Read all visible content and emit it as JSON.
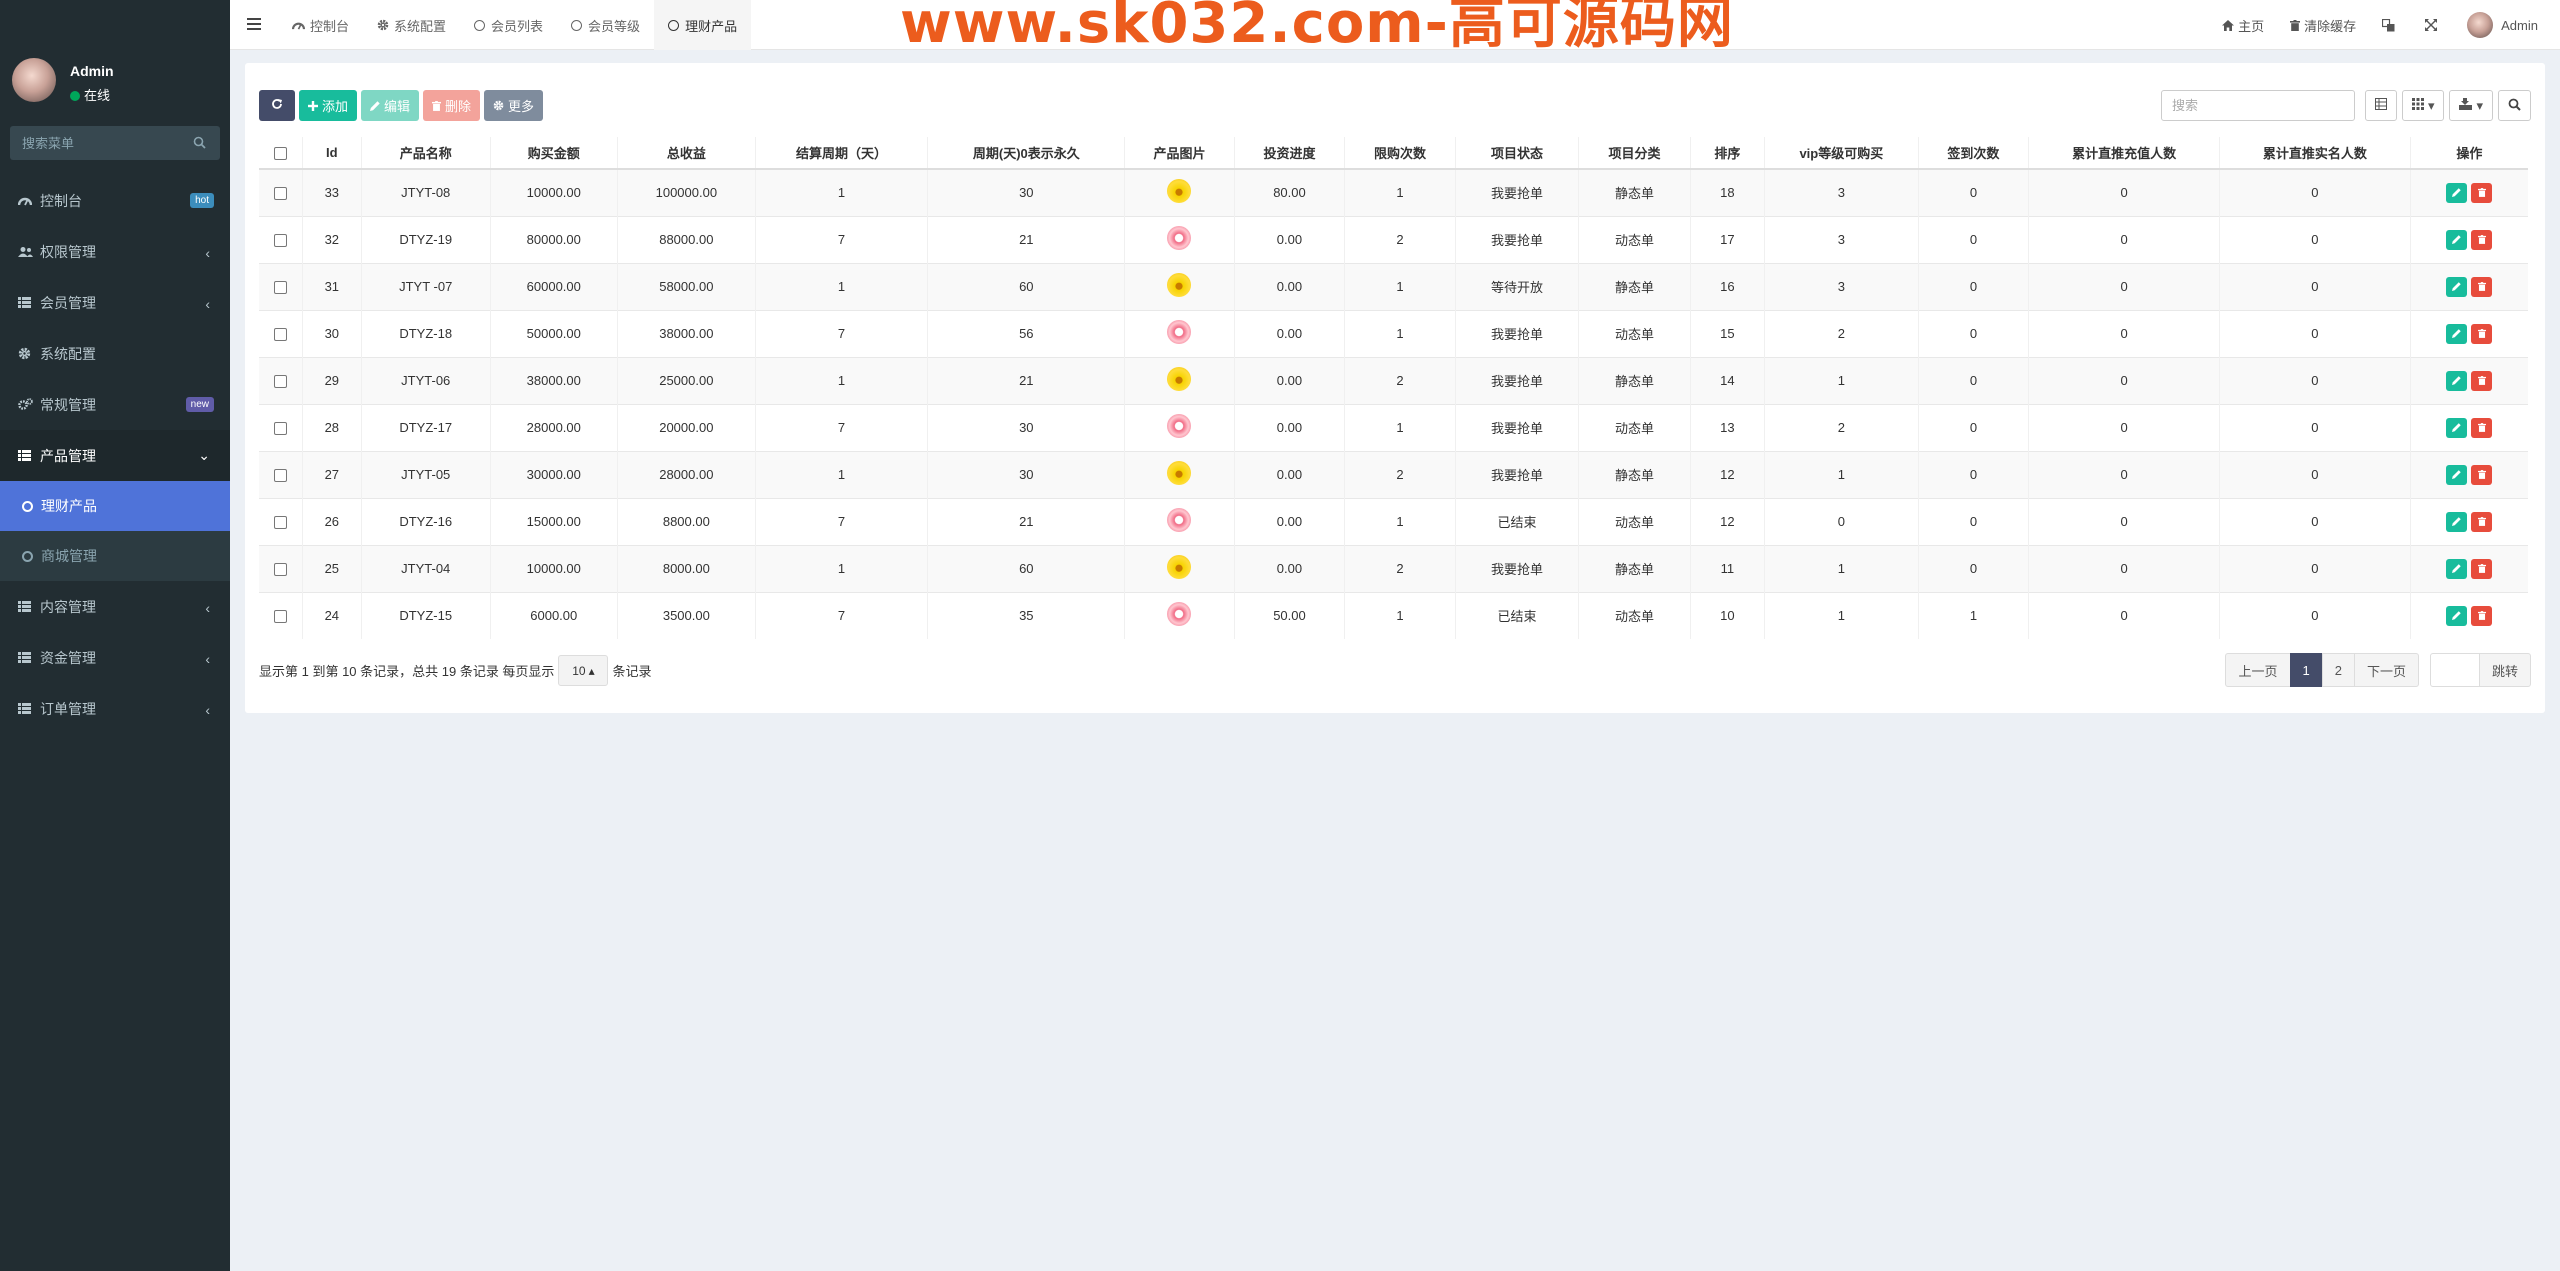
{
  "user": {
    "name": "Admin",
    "status": "在线"
  },
  "menu_search": {
    "placeholder": "搜索菜单"
  },
  "menu": {
    "items": [
      {
        "label": "控制台",
        "badge": "hot"
      },
      {
        "label": "权限管理"
      },
      {
        "label": "会员管理"
      },
      {
        "label": "系统配置"
      },
      {
        "label": "常规管理",
        "badge": "new"
      },
      {
        "label": "产品管理"
      }
    ],
    "product_sub": [
      {
        "label": "理财产品"
      },
      {
        "label": "商城管理"
      }
    ],
    "after": [
      {
        "label": "内容管理"
      },
      {
        "label": "资金管理"
      },
      {
        "label": "订单管理"
      }
    ]
  },
  "tabs": [
    {
      "label": "控制台"
    },
    {
      "label": "系统配置"
    },
    {
      "label": "会员列表"
    },
    {
      "label": "会员等级"
    },
    {
      "label": "理财产品"
    }
  ],
  "watermark": "www.sk032.com-高可源码网",
  "header_right": {
    "home": "主页",
    "clear_cache": "清除缓存",
    "user": "Admin"
  },
  "toolbar": {
    "add": "添加",
    "edit": "编辑",
    "delete": "删除",
    "more": "更多"
  },
  "search": {
    "placeholder": "搜索"
  },
  "table": {
    "columns": [
      "Id",
      "产品名称",
      "购买金额",
      "总收益",
      "结算周期（天）",
      "周期(天)0表示永久",
      "产品图片",
      "投资进度",
      "限购次数",
      "项目状态",
      "项目分类",
      "排序",
      "vip等级可购买",
      "签到次数",
      "累计直推充值人数",
      "累计直推实名人数",
      "操作"
    ],
    "rows": [
      {
        "id": "33",
        "name": "JTYT-08",
        "amount": "10000.00",
        "income": "100000.00",
        "settle": "1",
        "period": "30",
        "img": "yellow",
        "progress": "80.00",
        "limit": "1",
        "status": "我要抢单",
        "status_type": "green",
        "category": "静态单",
        "cat_type": "static",
        "sort": "18",
        "vip": "3",
        "sign": "0",
        "recharge": "0",
        "realname": "0"
      },
      {
        "id": "32",
        "name": "DTYZ-19",
        "amount": "80000.00",
        "income": "88000.00",
        "settle": "7",
        "period": "21",
        "img": "red",
        "progress": "0.00",
        "limit": "2",
        "status": "我要抢单",
        "status_type": "green",
        "category": "动态单",
        "cat_type": "dyn",
        "sort": "17",
        "vip": "3",
        "sign": "0",
        "recharge": "0",
        "realname": "0"
      },
      {
        "id": "31",
        "name": "JTYT -07",
        "amount": "60000.00",
        "income": "58000.00",
        "settle": "1",
        "period": "60",
        "img": "yellow",
        "progress": "0.00",
        "limit": "1",
        "status": "等待开放",
        "status_type": "red",
        "category": "静态单",
        "cat_type": "static",
        "sort": "16",
        "vip": "3",
        "sign": "0",
        "recharge": "0",
        "realname": "0"
      },
      {
        "id": "30",
        "name": "DTYZ-18",
        "amount": "50000.00",
        "income": "38000.00",
        "settle": "7",
        "period": "56",
        "img": "red",
        "progress": "0.00",
        "limit": "1",
        "status": "我要抢单",
        "status_type": "green",
        "category": "动态单",
        "cat_type": "dyn",
        "sort": "15",
        "vip": "2",
        "sign": "0",
        "recharge": "0",
        "realname": "0"
      },
      {
        "id": "29",
        "name": "JTYT-06",
        "amount": "38000.00",
        "income": "25000.00",
        "settle": "1",
        "period": "21",
        "img": "yellow",
        "progress": "0.00",
        "limit": "2",
        "status": "我要抢单",
        "status_type": "green",
        "category": "静态单",
        "cat_type": "static",
        "sort": "14",
        "vip": "1",
        "sign": "0",
        "recharge": "0",
        "realname": "0"
      },
      {
        "id": "28",
        "name": "DTYZ-17",
        "amount": "28000.00",
        "income": "20000.00",
        "settle": "7",
        "period": "30",
        "img": "red",
        "progress": "0.00",
        "limit": "1",
        "status": "我要抢单",
        "status_type": "green",
        "category": "动态单",
        "cat_type": "dyn",
        "sort": "13",
        "vip": "2",
        "sign": "0",
        "recharge": "0",
        "realname": "0"
      },
      {
        "id": "27",
        "name": "JTYT-05",
        "amount": "30000.00",
        "income": "28000.00",
        "settle": "1",
        "period": "30",
        "img": "yellow",
        "progress": "0.00",
        "limit": "2",
        "status": "我要抢单",
        "status_type": "green",
        "category": "静态单",
        "cat_type": "static",
        "sort": "12",
        "vip": "1",
        "sign": "0",
        "recharge": "0",
        "realname": "0"
      },
      {
        "id": "26",
        "name": "DTYZ-16",
        "amount": "15000.00",
        "income": "8800.00",
        "settle": "7",
        "period": "21",
        "img": "red",
        "progress": "0.00",
        "limit": "1",
        "status": "已结束",
        "status_type": "gray",
        "category": "动态单",
        "cat_type": "dyn",
        "sort": "12",
        "vip": "0",
        "sign": "0",
        "recharge": "0",
        "realname": "0"
      },
      {
        "id": "25",
        "name": "JTYT-04",
        "amount": "10000.00",
        "income": "8000.00",
        "settle": "1",
        "period": "60",
        "img": "yellow",
        "progress": "0.00",
        "limit": "2",
        "status": "我要抢单",
        "status_type": "green",
        "category": "静态单",
        "cat_type": "static",
        "sort": "11",
        "vip": "1",
        "sign": "0",
        "recharge": "0",
        "realname": "0"
      },
      {
        "id": "24",
        "name": "DTYZ-15",
        "amount": "6000.00",
        "income": "3500.00",
        "settle": "7",
        "period": "35",
        "img": "red",
        "progress": "50.00",
        "limit": "1",
        "status": "已结束",
        "status_type": "gray",
        "category": "动态单",
        "cat_type": "dyn",
        "sort": "10",
        "vip": "1",
        "sign": "1",
        "recharge": "0",
        "realname": "0"
      }
    ]
  },
  "footer": {
    "info": "显示第 1 到第 10 条记录，总共 19 条记录 每页显示",
    "page_size": "10",
    "suffix": "条记录"
  },
  "pager": {
    "prev": "上一页",
    "pages": [
      "1",
      "2"
    ],
    "next": "下一页",
    "jump": "跳转"
  },
  "colors": {
    "sidebar": "#222d32",
    "accent": "#4f73d9",
    "green": "#18bc9c",
    "red": "#e74c3c",
    "orange": "#f39c12",
    "dark_button": "#444c69"
  }
}
